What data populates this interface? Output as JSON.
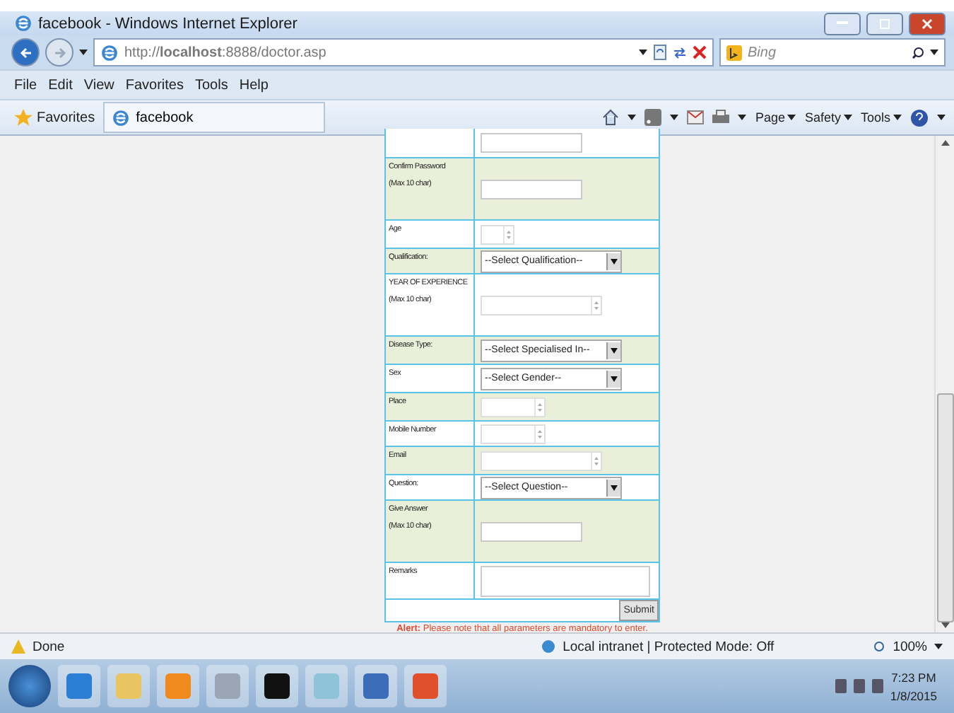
{
  "window": {
    "title": "facebook - Windows Internet Explorer"
  },
  "address": {
    "url": "http://**localhost**:8888/doctor.asp"
  },
  "search": {
    "placeholder": "Bing"
  },
  "menu": [
    "File",
    "Edit",
    "View",
    "Favorites",
    "Tools",
    "Help"
  ],
  "favorites": {
    "label": "Favorites",
    "tab": "facebook"
  },
  "commands": [
    "Page",
    "Safety",
    "Tools"
  ],
  "form": {
    "rows": [
      {
        "kind": "text",
        "label": ""
      },
      {
        "kind": "text",
        "label": "Confirm Password",
        "note": "(Max 10 char)"
      },
      {
        "kind": "spin",
        "label": "Age"
      },
      {
        "kind": "select",
        "label": "Qualification:",
        "value": "--Select Qualification--"
      },
      {
        "kind": "spin",
        "label": "YEAR OF EXPERIENCE",
        "note": "(Max 10 char)"
      },
      {
        "kind": "select",
        "label": "Disease Type:",
        "value": "--Select Specialised In--"
      },
      {
        "kind": "select",
        "label": "Sex",
        "value": "--Select Gender--"
      },
      {
        "kind": "spin",
        "label": "Place"
      },
      {
        "kind": "spin",
        "label": "Mobile Number"
      },
      {
        "kind": "spin",
        "label": "Email"
      },
      {
        "kind": "select",
        "label": "Question:",
        "value": "--Select Question--"
      },
      {
        "kind": "text",
        "label": "Give Answer",
        "note": "(Max 10 char)"
      },
      {
        "kind": "textarea",
        "label": "Remarks"
      }
    ],
    "submit": "Submit",
    "alert": "**Alert:** Please note that all parameters are mandatory to enter."
  },
  "status_bar": {
    "text": "Done",
    "zone": "Local intranet | Protected Mode: Off",
    "zoom": "100%"
  },
  "taskbar": {
    "time": "7:23 PM",
    "date": "1/8/2015"
  }
}
